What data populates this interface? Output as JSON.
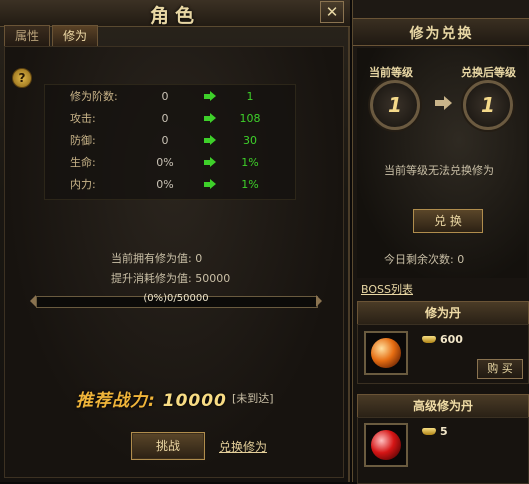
{
  "window": {
    "title": "角色",
    "close_label": "✕"
  },
  "tabs": [
    {
      "label": "属性",
      "active": false
    },
    {
      "label": "修为",
      "active": true
    }
  ],
  "help_label": "?",
  "stats": [
    {
      "label": "修为阶数:",
      "current": "0",
      "next": "1"
    },
    {
      "label": "攻击:",
      "current": "0",
      "next": "108"
    },
    {
      "label": "防御:",
      "current": "0",
      "next": "30"
    },
    {
      "label": "生命:",
      "current": "0%",
      "next": "1%"
    },
    {
      "label": "内力:",
      "current": "0%",
      "next": "1%"
    }
  ],
  "owned_text": "当前拥有修为值: 0",
  "cost_text": "提升消耗修为值: 50000",
  "progress": {
    "text": "(0%)0/50000",
    "fraction": 0.0
  },
  "power": {
    "label": "推荐战力:",
    "value": "10000",
    "status": "[未到达]"
  },
  "buttons": {
    "challenge": "挑战",
    "exchange_link": "兑换修为"
  },
  "exchange_panel": {
    "title": "修为兑换",
    "current_level_label": "当前等级",
    "after_level_label": "兑换后等级",
    "current_level": "1",
    "after_level": "1",
    "message": "当前等级无法兑换修为",
    "exchange_button": "兑 换",
    "remaining_text": "今日剩余次数: 0"
  },
  "boss_list_label": "BOSS列表",
  "shop_items": [
    {
      "name": "修为丹",
      "price": "600",
      "buy_label": "购 买",
      "color": "#e66d12"
    },
    {
      "name": "高级修为丹",
      "price": "5",
      "color": "#d51515"
    }
  ],
  "colors": {
    "accent_gold": "#f0b53a",
    "up_green": "#3ed02a",
    "text_beige": "#c9bfa6"
  }
}
